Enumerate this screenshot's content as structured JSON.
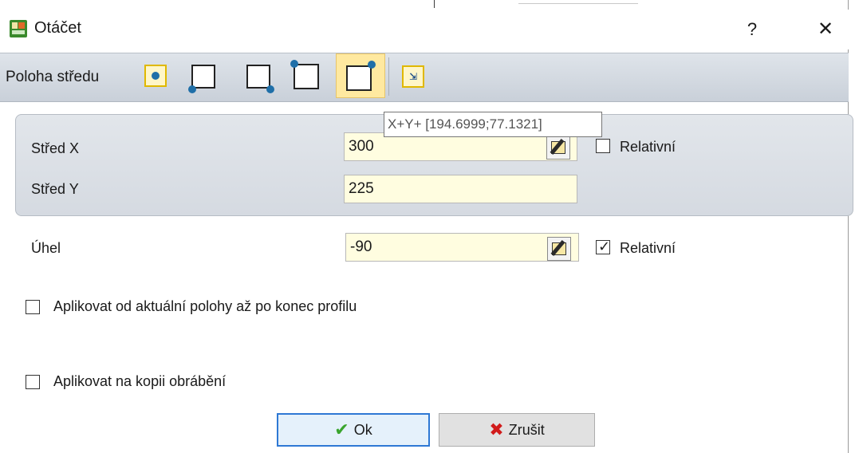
{
  "window": {
    "title": "Otáčet",
    "help_label": "?",
    "close_label": "✕"
  },
  "toolbar": {
    "label": "Poloha středu",
    "tools": [
      {
        "name": "center",
        "icon": "center-point-icon",
        "active": false
      },
      {
        "name": "bottom-left",
        "icon": "bottom-left-point-icon",
        "active": false
      },
      {
        "name": "bottom-right",
        "icon": "bottom-right-point-icon",
        "active": false
      },
      {
        "name": "top-left",
        "icon": "top-left-point-icon",
        "active": false
      },
      {
        "name": "top-right",
        "icon": "top-right-point-icon",
        "active": true
      },
      {
        "name": "pick-point",
        "icon": "pick-point-icon",
        "active": false
      }
    ]
  },
  "tooltip": "X+Y+ [194.6999;77.1321]",
  "center_group": {
    "x_label": "Střed X",
    "x_value": "300",
    "y_label": "Střed Y",
    "y_value": "225",
    "relative_label": "Relativní",
    "relative_checked": false
  },
  "angle": {
    "label": "Úhel",
    "value": "-90",
    "relative_label": "Relativní",
    "relative_checked": true
  },
  "options": {
    "apply_to_end_label": "Aplikovat od aktuální polohy až po konec profilu",
    "apply_to_end_checked": false,
    "apply_to_copy_label": "Aplikovat na kopii obrábění",
    "apply_to_copy_checked": false
  },
  "buttons": {
    "ok_label": "Ok",
    "cancel_label": "Zrušit"
  },
  "colors": {
    "input_bg": "#fffde0",
    "active_tool": "#ffe9a0",
    "ok_border": "#2e78d4"
  }
}
